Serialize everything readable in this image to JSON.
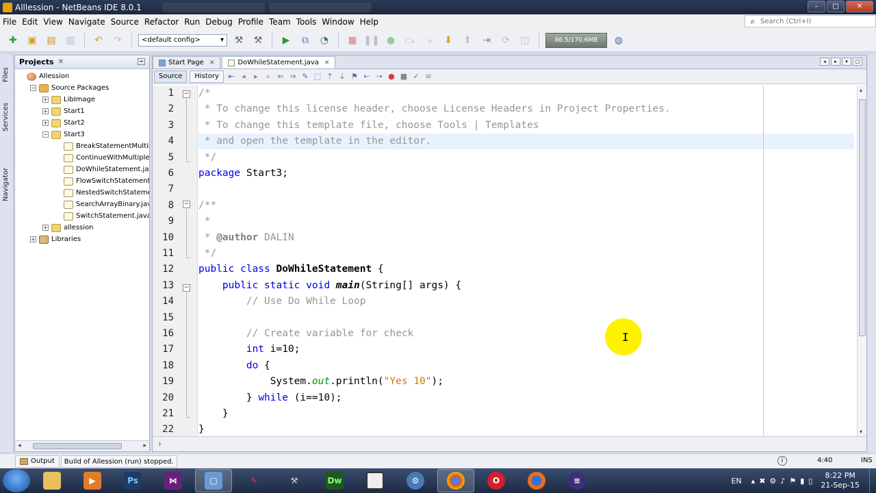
{
  "window": {
    "title": "Alllession - NetBeans IDE 8.0.1"
  },
  "menu": [
    "File",
    "Edit",
    "View",
    "Navigate",
    "Source",
    "Refactor",
    "Run",
    "Debug",
    "Profile",
    "Team",
    "Tools",
    "Window",
    "Help"
  ],
  "search": {
    "placeholder": "Search (Ctrl+I)"
  },
  "toolbar": {
    "config": "<default config>",
    "memory": "86.5/170.6MB"
  },
  "side_tabs": [
    "Files",
    "Services",
    "Navigator"
  ],
  "projects": {
    "title": "Projects",
    "tree": [
      {
        "label": "Allession",
        "depth": 0,
        "type": "project",
        "expander": ""
      },
      {
        "label": "Source Packages",
        "depth": 1,
        "type": "packages",
        "expander": "−"
      },
      {
        "label": "LibImage",
        "depth": 2,
        "type": "package",
        "expander": "+"
      },
      {
        "label": "Start1",
        "depth": 2,
        "type": "package",
        "expander": "+"
      },
      {
        "label": "Start2",
        "depth": 2,
        "type": "package",
        "expander": "+"
      },
      {
        "label": "Start3",
        "depth": 2,
        "type": "package",
        "expander": "−"
      },
      {
        "label": "BreakStatementMultipleA",
        "depth": 3,
        "type": "java",
        "expander": ""
      },
      {
        "label": "ContinueWithMultipleArra",
        "depth": 3,
        "type": "java",
        "expander": ""
      },
      {
        "label": "DoWhileStatement.java",
        "depth": 3,
        "type": "java",
        "expander": ""
      },
      {
        "label": "FlowSwitchStatement.jav",
        "depth": 3,
        "type": "java",
        "expander": ""
      },
      {
        "label": "NestedSwitchStatement.",
        "depth": 3,
        "type": "java",
        "expander": ""
      },
      {
        "label": "SearchArrayBinary.java",
        "depth": 3,
        "type": "java",
        "expander": ""
      },
      {
        "label": "SwitchStatement.java",
        "depth": 3,
        "type": "java",
        "expander": ""
      },
      {
        "label": "allession",
        "depth": 2,
        "type": "package",
        "expander": "+"
      },
      {
        "label": "Libraries",
        "depth": 1,
        "type": "lib",
        "expander": "+"
      }
    ]
  },
  "editor": {
    "tabs": [
      {
        "label": "Start Page",
        "active": false
      },
      {
        "label": "DoWhileStatement.java",
        "active": true
      }
    ],
    "view_tabs": {
      "source": "Source",
      "history": "History"
    },
    "line_numbers": [
      "1",
      "2",
      "3",
      "4",
      "5",
      "6",
      "7",
      "8",
      "9",
      "10",
      "11",
      "12",
      "13",
      "14",
      "15",
      "16",
      "17",
      "18",
      "19",
      "20",
      "21",
      "22"
    ],
    "code_lines": [
      [
        {
          "c": "cmt",
          "t": "/*"
        }
      ],
      [
        {
          "c": "cmt",
          "t": " * To change this license header, choose License Headers in Project Properties."
        }
      ],
      [
        {
          "c": "cmt",
          "t": " * To change this template file, choose Tools | Templates"
        }
      ],
      [
        {
          "c": "cmt",
          "t": " * and open the template in the editor."
        }
      ],
      [
        {
          "c": "cmt",
          "t": " */"
        }
      ],
      [
        {
          "c": "kw",
          "t": "package"
        },
        {
          "c": "",
          "t": " Start3;"
        }
      ],
      [
        {
          "c": "",
          "t": ""
        }
      ],
      [
        {
          "c": "cmt",
          "t": "/**"
        }
      ],
      [
        {
          "c": "cmt",
          "t": " *"
        }
      ],
      [
        {
          "c": "cmt",
          "t": " * "
        },
        {
          "c": "tag",
          "t": "@author"
        },
        {
          "c": "cmt",
          "t": " DALIN"
        }
      ],
      [
        {
          "c": "cmt",
          "t": " */"
        }
      ],
      [
        {
          "c": "kw",
          "t": "public class "
        },
        {
          "c": "cls",
          "t": "DoWhileStatement"
        },
        {
          "c": "",
          "t": " {"
        }
      ],
      [
        {
          "c": "",
          "t": "    "
        },
        {
          "c": "kw",
          "t": "public static void "
        },
        {
          "c": "meth",
          "t": "main"
        },
        {
          "c": "",
          "t": "(String[] args) {"
        }
      ],
      [
        {
          "c": "",
          "t": "        "
        },
        {
          "c": "cmt",
          "t": "// Use Do While Loop"
        }
      ],
      [
        {
          "c": "",
          "t": ""
        }
      ],
      [
        {
          "c": "",
          "t": "        "
        },
        {
          "c": "cmt",
          "t": "// Create variable for check"
        }
      ],
      [
        {
          "c": "",
          "t": "        "
        },
        {
          "c": "kw",
          "t": "int"
        },
        {
          "c": "",
          "t": " i=10;"
        }
      ],
      [
        {
          "c": "",
          "t": "        "
        },
        {
          "c": "kw",
          "t": "do"
        },
        {
          "c": "",
          "t": " {"
        }
      ],
      [
        {
          "c": "",
          "t": "            System."
        },
        {
          "c": "fld",
          "t": "out"
        },
        {
          "c": "",
          "t": ".println("
        },
        {
          "c": "str",
          "t": "\"Yes 10\""
        },
        {
          "c": "",
          "t": ");"
        }
      ],
      [
        {
          "c": "",
          "t": "        } "
        },
        {
          "c": "kw",
          "t": "while"
        },
        {
          "c": "",
          "t": " (i==10);"
        }
      ],
      [
        {
          "c": "",
          "t": "    }"
        }
      ],
      [
        {
          "c": "",
          "t": "}"
        }
      ]
    ]
  },
  "status": {
    "output_label": "Output",
    "message": "Build of Allession (run) stopped.",
    "position": "4:40",
    "mode": "INS"
  },
  "taskbar": {
    "apps": [
      "explorer",
      "media",
      "Ps",
      "VS",
      "virtualbox",
      "tool",
      "tool2",
      "Dw",
      "window",
      "network",
      "chrome",
      "opera",
      "firefox",
      "eclipse"
    ],
    "lang": "EN",
    "time": "8:22 PM",
    "date": "21-Sep-15"
  }
}
